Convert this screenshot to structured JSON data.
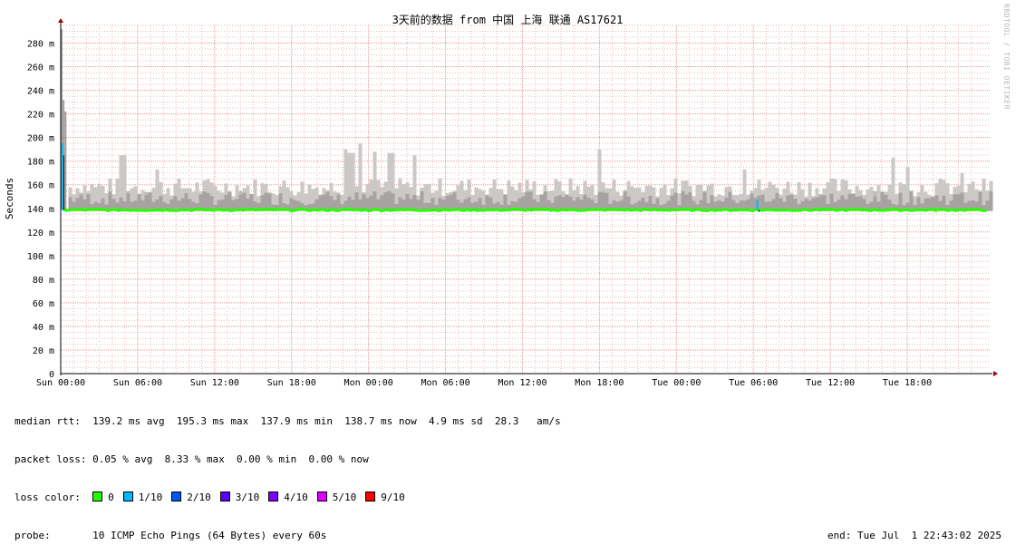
{
  "chart_data": {
    "type": "line",
    "title": "3天前的数据 from 中国 上海 联通 AS17621",
    "ylabel": "Seconds",
    "xlabel": "",
    "ylim": [
      0,
      295
    ],
    "y_ticks": [
      {
        "value": 0,
        "label": "0"
      },
      {
        "value": 20,
        "label": "20 m"
      },
      {
        "value": 40,
        "label": "40 m"
      },
      {
        "value": 60,
        "label": "60 m"
      },
      {
        "value": 80,
        "label": "80 m"
      },
      {
        "value": 100,
        "label": "100 m"
      },
      {
        "value": 120,
        "label": "120 m"
      },
      {
        "value": 140,
        "label": "140 m"
      },
      {
        "value": 160,
        "label": "160 m"
      },
      {
        "value": 180,
        "label": "180 m"
      },
      {
        "value": 200,
        "label": "200 m"
      },
      {
        "value": 220,
        "label": "220 m"
      },
      {
        "value": 240,
        "label": "240 m"
      },
      {
        "value": 260,
        "label": "260 m"
      },
      {
        "value": 280,
        "label": "280 m"
      }
    ],
    "x_ticks": [
      "Sun 00:00",
      "Sun 06:00",
      "Sun 12:00",
      "Sun 18:00",
      "Mon 00:00",
      "Mon 06:00",
      "Mon 12:00",
      "Mon 18:00",
      "Tue 00:00",
      "Tue 06:00",
      "Tue 12:00",
      "Tue 18:00"
    ],
    "x_range_hours": [
      0,
      72.5
    ],
    "grid": true,
    "series": [
      {
        "name": "median rtt",
        "values_ms_approx": {
          "baseline": 138.7,
          "avg": 139.2,
          "max": 195.3,
          "min": 137.9
        }
      },
      {
        "name": "packet loss",
        "values_pct": {
          "avg": 0.05,
          "max": 8.33,
          "min": 0.0,
          "now": 0.0
        }
      }
    ],
    "smoke_envelope": {
      "typical_top_ms": 160,
      "spikes": [
        {
          "hour": 0.0,
          "top_ms": 292
        },
        {
          "hour": 0.15,
          "top_ms": 232
        },
        {
          "hour": 0.3,
          "top_ms": 222
        },
        {
          "hour": 4.5,
          "top_ms": 190
        },
        {
          "hour": 4.7,
          "top_ms": 185
        },
        {
          "hour": 7.4,
          "top_ms": 173
        },
        {
          "hour": 22.2,
          "top_ms": 190
        },
        {
          "hour": 22.5,
          "top_ms": 187
        },
        {
          "hour": 23.3,
          "top_ms": 195
        },
        {
          "hour": 24.3,
          "top_ms": 188
        },
        {
          "hour": 25.6,
          "top_ms": 187
        },
        {
          "hour": 27.5,
          "top_ms": 185
        },
        {
          "hour": 41.8,
          "top_ms": 190
        },
        {
          "hour": 53.2,
          "top_ms": 173
        },
        {
          "hour": 64.8,
          "top_ms": 183
        },
        {
          "hour": 65.9,
          "top_ms": 175
        },
        {
          "hour": 70.1,
          "top_ms": 170
        }
      ],
      "loss_spikes": [
        {
          "hour": 0.1,
          "median_ms": 195
        },
        {
          "hour": 54.3,
          "median_ms": 147
        }
      ]
    }
  },
  "colors": {
    "loss_0": "#26ff00",
    "loss_1": "#00b8ff",
    "loss_2": "#0059ff",
    "loss_3": "#5e00ff",
    "loss_4": "#7e00ff",
    "loss_5": "#dd00ff",
    "loss_9": "#ff0000",
    "smoke_light": "#cdc8c8",
    "smoke_dark": "#8a8585",
    "grid_minor": "#f0b8b8",
    "grid_major": "#e89a9a",
    "axis_arrow": "#a00000"
  },
  "legend": {
    "median_label": "median rtt:",
    "median_values": "139.2 ms avg  195.3 ms max  137.9 ms min  138.7 ms now  4.9 ms sd  28.3   am/s",
    "loss_label": "packet loss:",
    "loss_values": "0.05 % avg  8.33 % max  0.00 % min  0.00 % now",
    "loss_color_label": "loss color:",
    "loss_colors": [
      {
        "label": "0",
        "color": "#26ff00"
      },
      {
        "label": "1/10",
        "color": "#00b8ff"
      },
      {
        "label": "2/10",
        "color": "#0059ff"
      },
      {
        "label": "3/10",
        "color": "#5e00ff"
      },
      {
        "label": "4/10",
        "color": "#7e00ff"
      },
      {
        "label": "5/10",
        "color": "#dd00ff"
      },
      {
        "label": "9/10",
        "color": "#ff0000"
      }
    ],
    "probe_label": "probe:",
    "probe_value": "10 ICMP Echo Pings (64 Bytes) every 60s",
    "end_text": "end: Tue Jul  1 22:43:02 2025"
  },
  "watermark": "RRDTOOL / TOBI OETIKER"
}
